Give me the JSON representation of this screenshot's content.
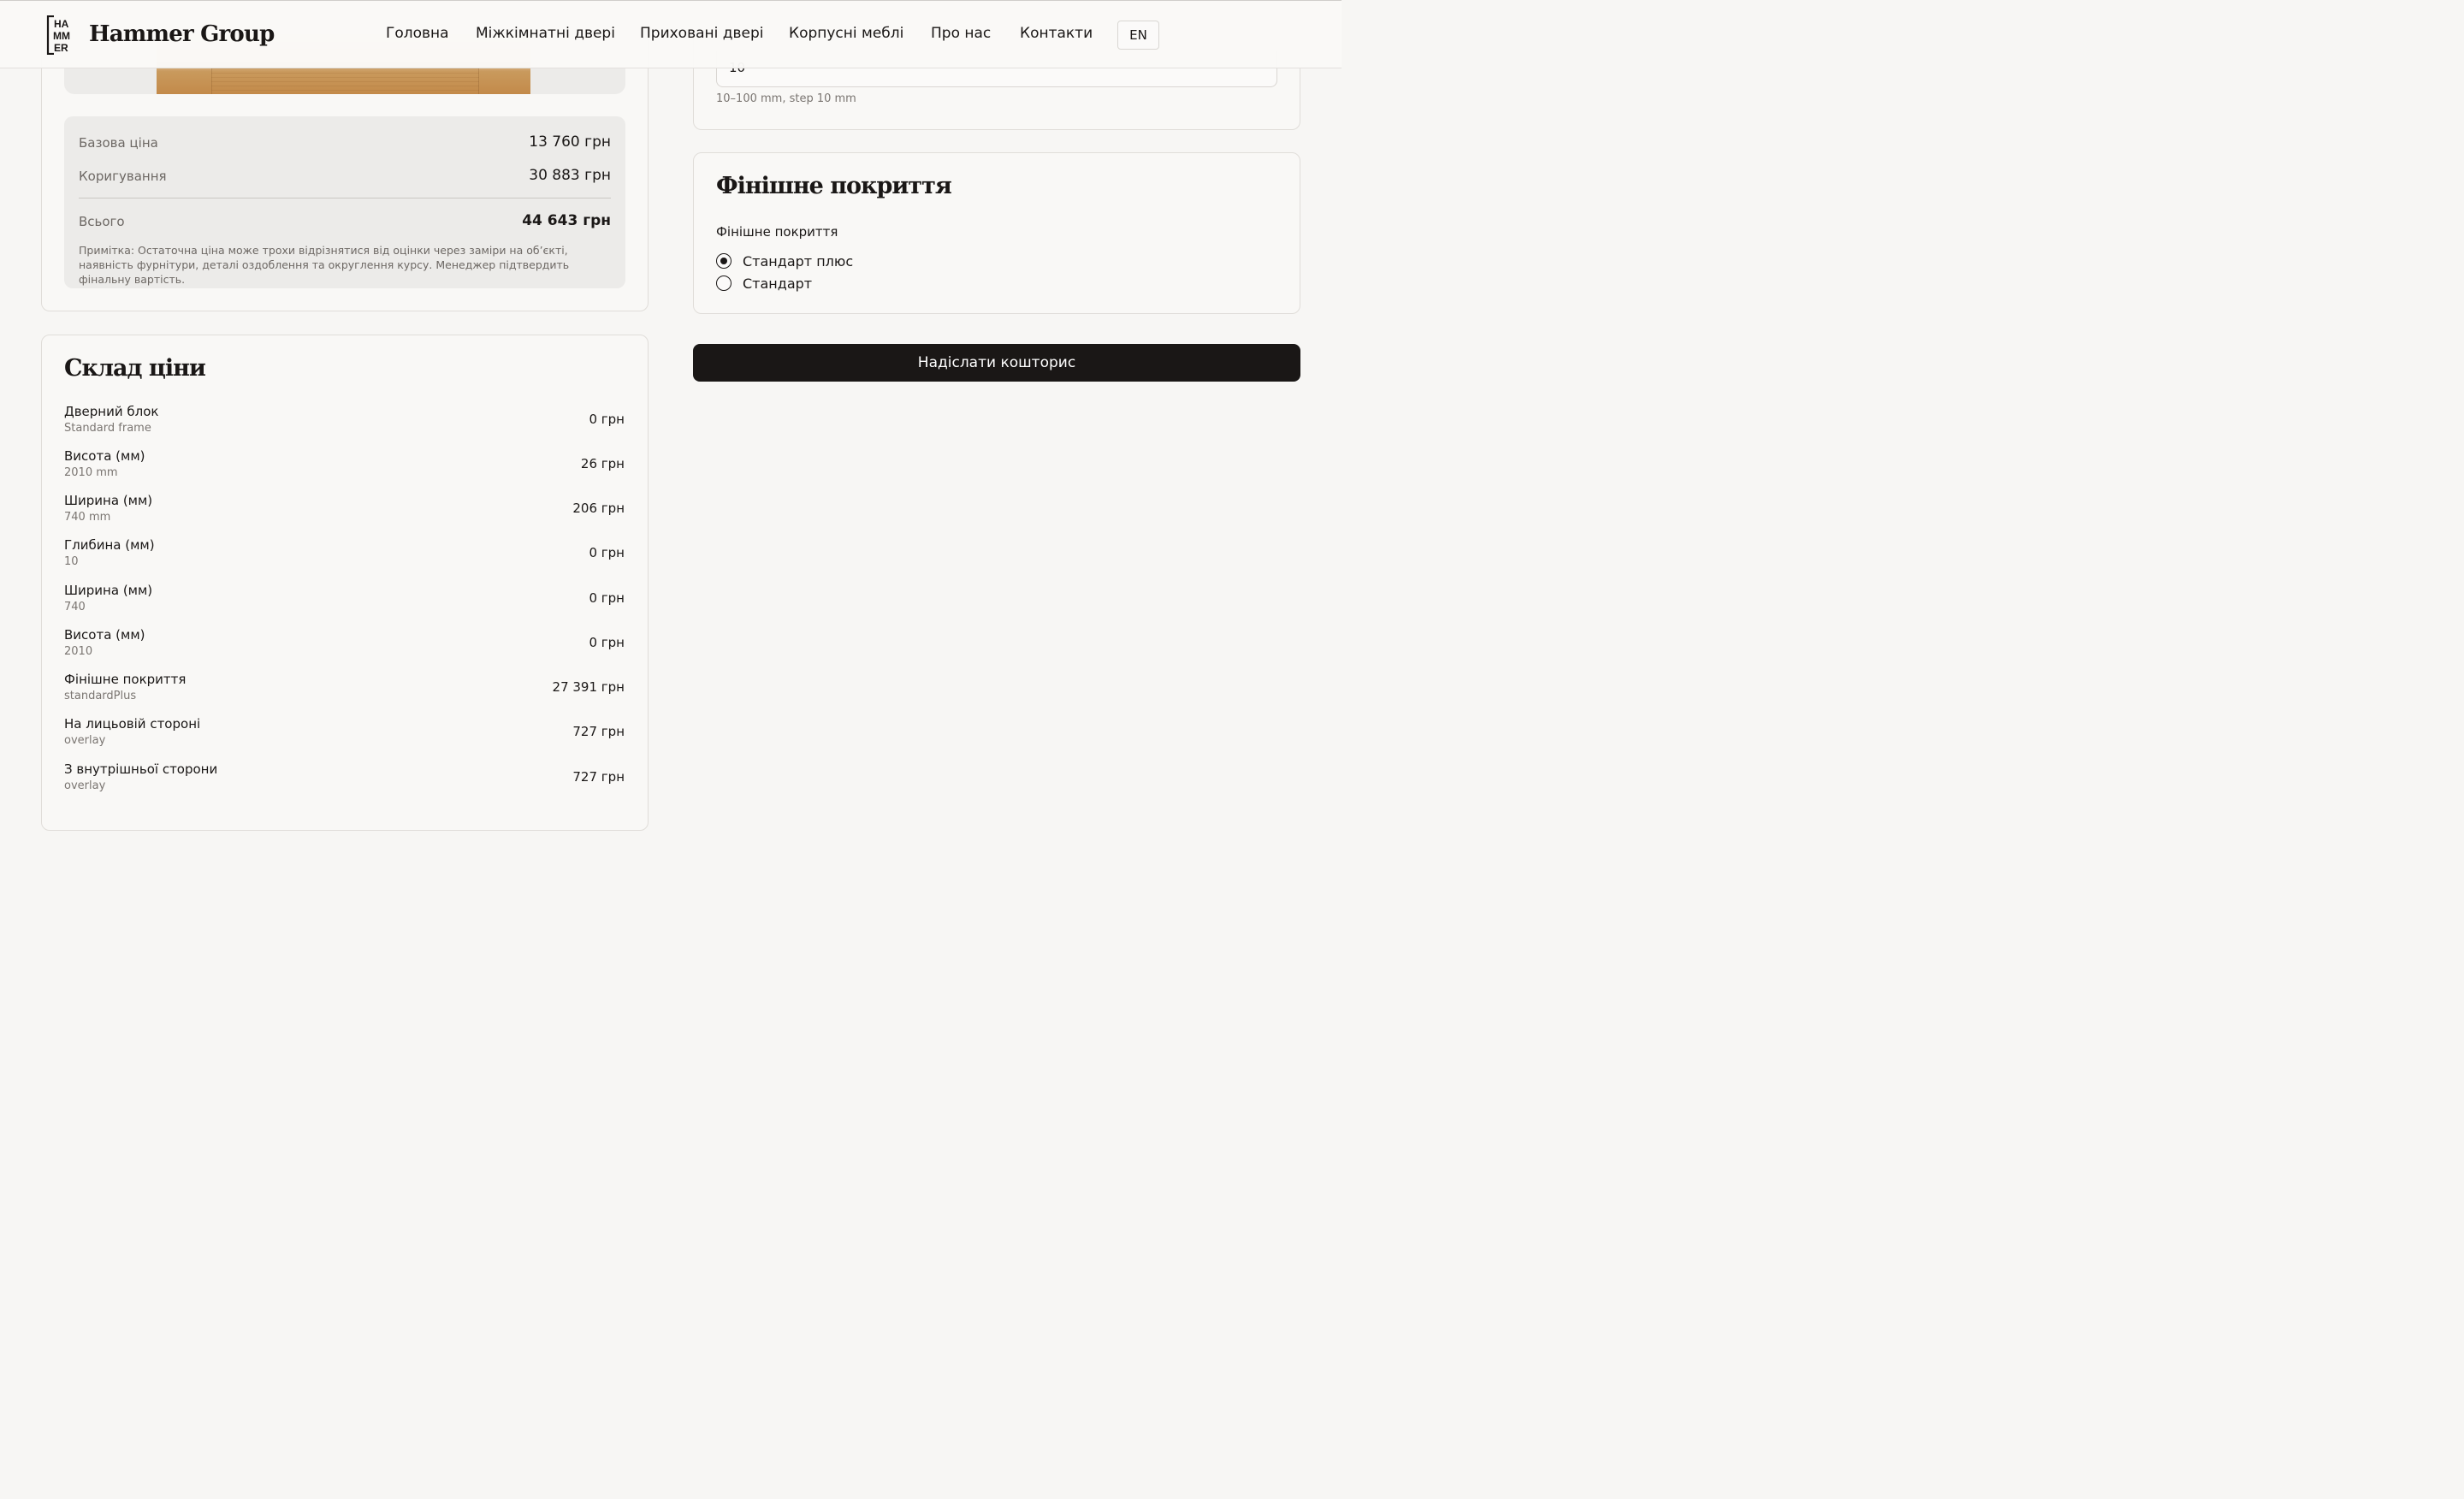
{
  "header": {
    "brand": "Hammer Group",
    "logo_letters": [
      "HA",
      "MM",
      "ER"
    ],
    "nav": [
      "Головна",
      "Міжкімнатні двері",
      "Приховані двері",
      "Корпусні меблі",
      "Про нас",
      "Контакти"
    ],
    "lang": "EN"
  },
  "summary": {
    "base_label": "Базова ціна",
    "base_value": "13 760 грн",
    "adjust_label": "Коригування",
    "adjust_value": "30 883 грн",
    "total_label": "Всього",
    "total_value": "44 643 грн",
    "note": "Примітка: Остаточна ціна може трохи відрізнятися від оцінки через заміри на об’єкті, наявність фурнітури, деталі оздоблення та округлення курсу. Менеджер підтвердить фінальну вартість."
  },
  "breakdown": {
    "title": "Склад ціни",
    "rows": [
      {
        "name": "Дверний блок",
        "sub": "Standard frame",
        "value": "0 грн"
      },
      {
        "name": "Висота (мм)",
        "sub": "2010 mm",
        "value": "26 грн"
      },
      {
        "name": "Ширина (мм)",
        "sub": "740 mm",
        "value": "206 грн"
      },
      {
        "name": "Глибина (мм)",
        "sub": "10",
        "value": "0 грн"
      },
      {
        "name": "Ширина (мм)",
        "sub": "740",
        "value": "0 грн"
      },
      {
        "name": "Висота (мм)",
        "sub": "2010",
        "value": "0 грн"
      },
      {
        "name": "Фінішне покриття",
        "sub": "standardPlus",
        "value": "27 391 грн"
      },
      {
        "name": "На лицьовій стороні",
        "sub": "overlay",
        "value": "727 грн"
      },
      {
        "name": "З внутрішньої сторони",
        "sub": "overlay",
        "value": "727 грн"
      }
    ]
  },
  "depth": {
    "value": "10",
    "hint": "10–100 mm, step 10 mm"
  },
  "finish": {
    "title": "Фінішне покриття",
    "label": "Фінішне покриття",
    "options": [
      {
        "label": "Стандарт плюс",
        "selected": true
      },
      {
        "label": "Стандарт",
        "selected": false
      }
    ]
  },
  "submit_label": "Надіслати кошторис"
}
